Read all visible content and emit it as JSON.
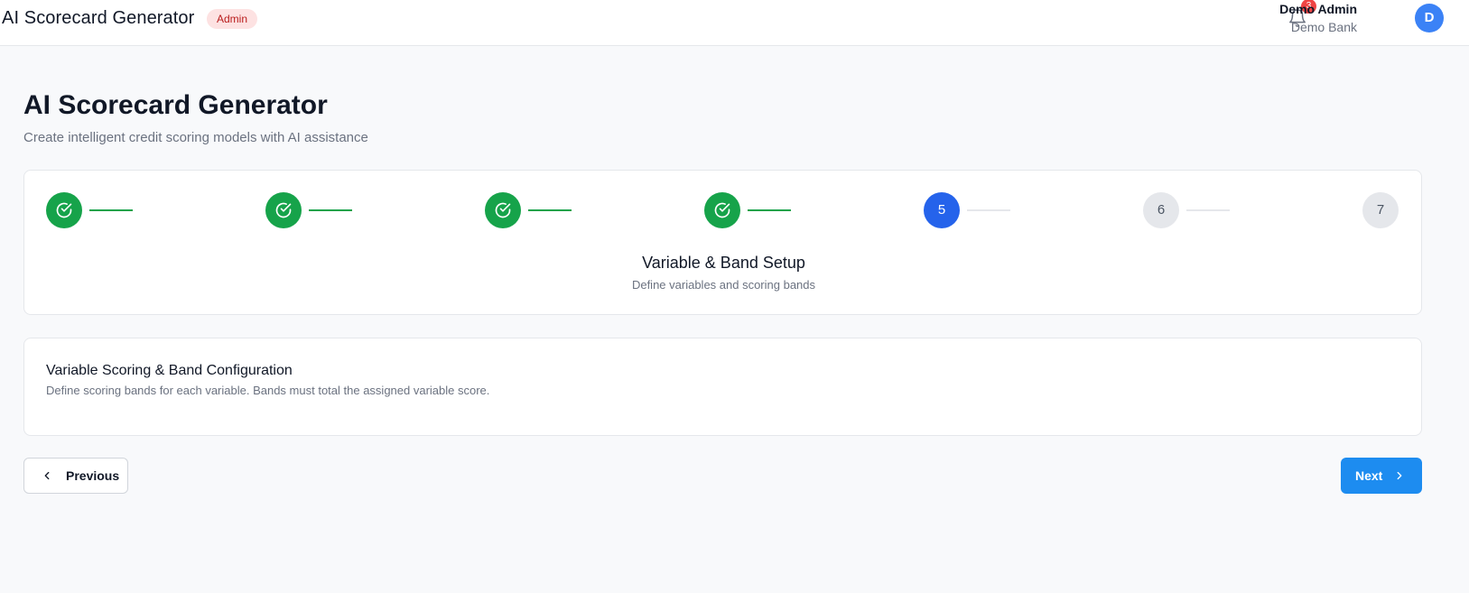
{
  "header": {
    "app_title": "AI Scorecard Generator",
    "role_badge": "Admin",
    "notification_count": "3",
    "user_name": "Demo Admin",
    "user_org": "Demo Bank",
    "avatar_initial": "D"
  },
  "page": {
    "title": "AI Scorecard Generator",
    "subtitle": "Create intelligent credit scoring models with AI assistance"
  },
  "stepper": {
    "steps": [
      {
        "label": "1",
        "status": "done"
      },
      {
        "label": "2",
        "status": "done"
      },
      {
        "label": "3",
        "status": "done"
      },
      {
        "label": "4",
        "status": "done"
      },
      {
        "label": "5",
        "status": "active"
      },
      {
        "label": "6",
        "status": "pending"
      },
      {
        "label": "7",
        "status": "pending"
      }
    ],
    "current_title": "Variable & Band Setup",
    "current_description": "Define variables and scoring bands"
  },
  "config": {
    "title": "Variable Scoring & Band Configuration",
    "description": "Define scoring bands for each variable. Bands must total the assigned variable score."
  },
  "nav": {
    "previous_label": "Previous",
    "next_label": "Next"
  },
  "colors": {
    "done": "#16a34a",
    "active": "#2563eb",
    "pending": "#e5e7eb",
    "primary_button": "#1d8cf0",
    "badge_bg": "#fde2e2"
  }
}
